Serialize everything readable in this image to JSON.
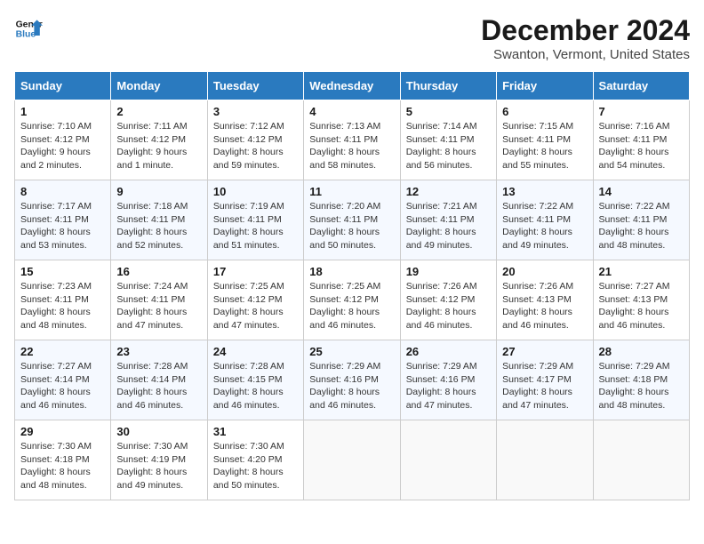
{
  "logo": {
    "line1": "General",
    "line2": "Blue"
  },
  "title": "December 2024",
  "location": "Swanton, Vermont, United States",
  "days_of_week": [
    "Sunday",
    "Monday",
    "Tuesday",
    "Wednesday",
    "Thursday",
    "Friday",
    "Saturday"
  ],
  "weeks": [
    [
      {
        "day": "1",
        "sunrise": "7:10 AM",
        "sunset": "4:12 PM",
        "daylight": "9 hours and 2 minutes."
      },
      {
        "day": "2",
        "sunrise": "7:11 AM",
        "sunset": "4:12 PM",
        "daylight": "9 hours and 1 minute."
      },
      {
        "day": "3",
        "sunrise": "7:12 AM",
        "sunset": "4:12 PM",
        "daylight": "8 hours and 59 minutes."
      },
      {
        "day": "4",
        "sunrise": "7:13 AM",
        "sunset": "4:11 PM",
        "daylight": "8 hours and 58 minutes."
      },
      {
        "day": "5",
        "sunrise": "7:14 AM",
        "sunset": "4:11 PM",
        "daylight": "8 hours and 56 minutes."
      },
      {
        "day": "6",
        "sunrise": "7:15 AM",
        "sunset": "4:11 PM",
        "daylight": "8 hours and 55 minutes."
      },
      {
        "day": "7",
        "sunrise": "7:16 AM",
        "sunset": "4:11 PM",
        "daylight": "8 hours and 54 minutes."
      }
    ],
    [
      {
        "day": "8",
        "sunrise": "7:17 AM",
        "sunset": "4:11 PM",
        "daylight": "8 hours and 53 minutes."
      },
      {
        "day": "9",
        "sunrise": "7:18 AM",
        "sunset": "4:11 PM",
        "daylight": "8 hours and 52 minutes."
      },
      {
        "day": "10",
        "sunrise": "7:19 AM",
        "sunset": "4:11 PM",
        "daylight": "8 hours and 51 minutes."
      },
      {
        "day": "11",
        "sunrise": "7:20 AM",
        "sunset": "4:11 PM",
        "daylight": "8 hours and 50 minutes."
      },
      {
        "day": "12",
        "sunrise": "7:21 AM",
        "sunset": "4:11 PM",
        "daylight": "8 hours and 49 minutes."
      },
      {
        "day": "13",
        "sunrise": "7:22 AM",
        "sunset": "4:11 PM",
        "daylight": "8 hours and 49 minutes."
      },
      {
        "day": "14",
        "sunrise": "7:22 AM",
        "sunset": "4:11 PM",
        "daylight": "8 hours and 48 minutes."
      }
    ],
    [
      {
        "day": "15",
        "sunrise": "7:23 AM",
        "sunset": "4:11 PM",
        "daylight": "8 hours and 48 minutes."
      },
      {
        "day": "16",
        "sunrise": "7:24 AM",
        "sunset": "4:11 PM",
        "daylight": "8 hours and 47 minutes."
      },
      {
        "day": "17",
        "sunrise": "7:25 AM",
        "sunset": "4:12 PM",
        "daylight": "8 hours and 47 minutes."
      },
      {
        "day": "18",
        "sunrise": "7:25 AM",
        "sunset": "4:12 PM",
        "daylight": "8 hours and 46 minutes."
      },
      {
        "day": "19",
        "sunrise": "7:26 AM",
        "sunset": "4:12 PM",
        "daylight": "8 hours and 46 minutes."
      },
      {
        "day": "20",
        "sunrise": "7:26 AM",
        "sunset": "4:13 PM",
        "daylight": "8 hours and 46 minutes."
      },
      {
        "day": "21",
        "sunrise": "7:27 AM",
        "sunset": "4:13 PM",
        "daylight": "8 hours and 46 minutes."
      }
    ],
    [
      {
        "day": "22",
        "sunrise": "7:27 AM",
        "sunset": "4:14 PM",
        "daylight": "8 hours and 46 minutes."
      },
      {
        "day": "23",
        "sunrise": "7:28 AM",
        "sunset": "4:14 PM",
        "daylight": "8 hours and 46 minutes."
      },
      {
        "day": "24",
        "sunrise": "7:28 AM",
        "sunset": "4:15 PM",
        "daylight": "8 hours and 46 minutes."
      },
      {
        "day": "25",
        "sunrise": "7:29 AM",
        "sunset": "4:16 PM",
        "daylight": "8 hours and 46 minutes."
      },
      {
        "day": "26",
        "sunrise": "7:29 AM",
        "sunset": "4:16 PM",
        "daylight": "8 hours and 47 minutes."
      },
      {
        "day": "27",
        "sunrise": "7:29 AM",
        "sunset": "4:17 PM",
        "daylight": "8 hours and 47 minutes."
      },
      {
        "day": "28",
        "sunrise": "7:29 AM",
        "sunset": "4:18 PM",
        "daylight": "8 hours and 48 minutes."
      }
    ],
    [
      {
        "day": "29",
        "sunrise": "7:30 AM",
        "sunset": "4:18 PM",
        "daylight": "8 hours and 48 minutes."
      },
      {
        "day": "30",
        "sunrise": "7:30 AM",
        "sunset": "4:19 PM",
        "daylight": "8 hours and 49 minutes."
      },
      {
        "day": "31",
        "sunrise": "7:30 AM",
        "sunset": "4:20 PM",
        "daylight": "8 hours and 50 minutes."
      },
      null,
      null,
      null,
      null
    ]
  ]
}
